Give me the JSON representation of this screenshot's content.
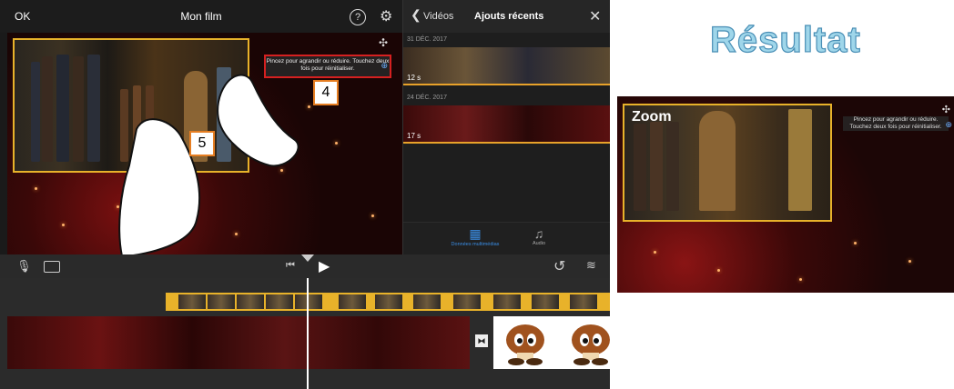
{
  "imovie": {
    "ok_label": "OK",
    "project_title": "Mon film",
    "help_icon": "question-icon",
    "settings_icon": "gear-icon"
  },
  "viewer": {
    "hint_text": "Pincez pour agrandir ou réduire. Touchez deux fois pour réinitialiser.",
    "annotation_4": "4",
    "annotation_5": "5"
  },
  "browser": {
    "back_label": "Vidéos",
    "title": "Ajouts récents",
    "sections": [
      {
        "date": "31 DÉC. 2017",
        "duration": "12 s"
      },
      {
        "date": "24 DÉC. 2017",
        "duration": "17 s"
      }
    ],
    "tabs": [
      {
        "label": "Données multimédias",
        "icon": "film-icon",
        "active": true
      },
      {
        "label": "Audio",
        "icon": "music-note-icon",
        "active": false
      }
    ]
  },
  "controls": {
    "mic_icon": "microphone-icon",
    "camera_icon": "camera-icon",
    "skip_icon": "skip-back-icon",
    "play_icon": "play-icon",
    "undo_icon": "undo-icon",
    "waveform_icon": "waveform-icon"
  },
  "result": {
    "title": "Résultat",
    "zoom_label": "Zoom",
    "hint_text": "Pincez pour agrandir ou réduire. Touchez deux fois pour réinitialiser."
  },
  "colors": {
    "accent_yellow": "#e8b22a",
    "annotation_red": "#d62020",
    "badge_orange": "#e67e22",
    "active_tab_blue": "#3a8ee6",
    "result_title": "#9fd6ea"
  }
}
